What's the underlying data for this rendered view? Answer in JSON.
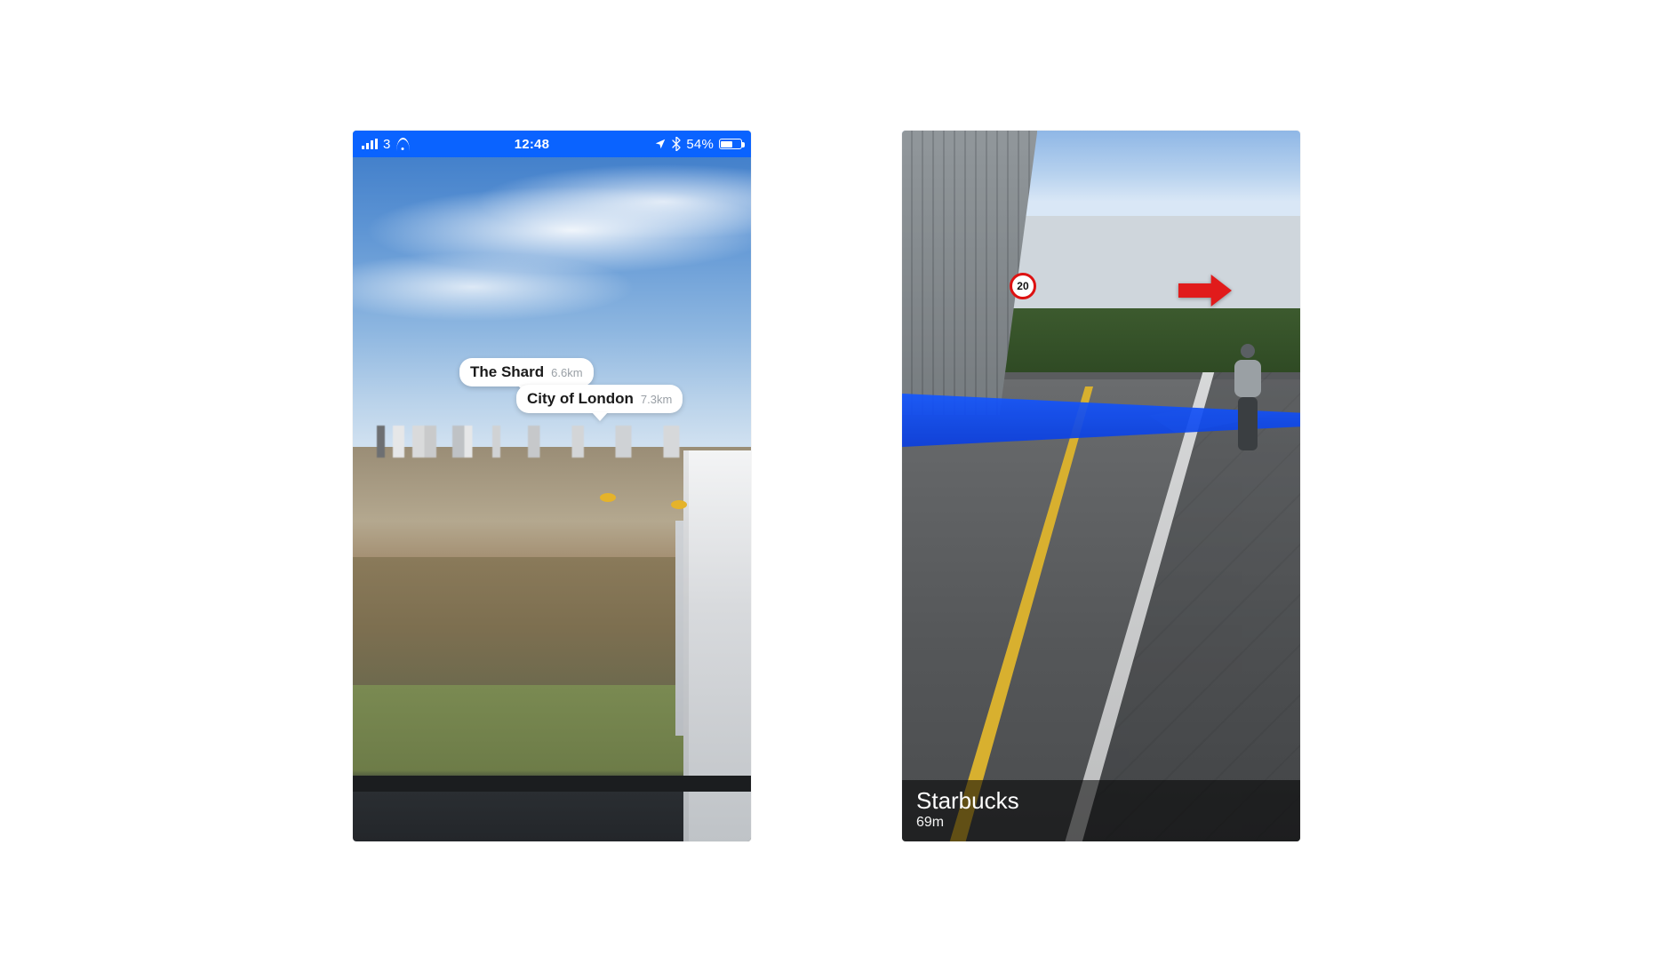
{
  "left": {
    "statusbar": {
      "carrier": "3",
      "time": "12:48",
      "battery_pct": "54%"
    },
    "pois": {
      "shard": {
        "name": "The Shard",
        "distance": "6.6km"
      },
      "city": {
        "name": "City of London",
        "distance": "7.3km"
      }
    }
  },
  "right": {
    "speed_limit": "20",
    "destination": {
      "name": "Starbucks",
      "distance": "69m"
    }
  }
}
